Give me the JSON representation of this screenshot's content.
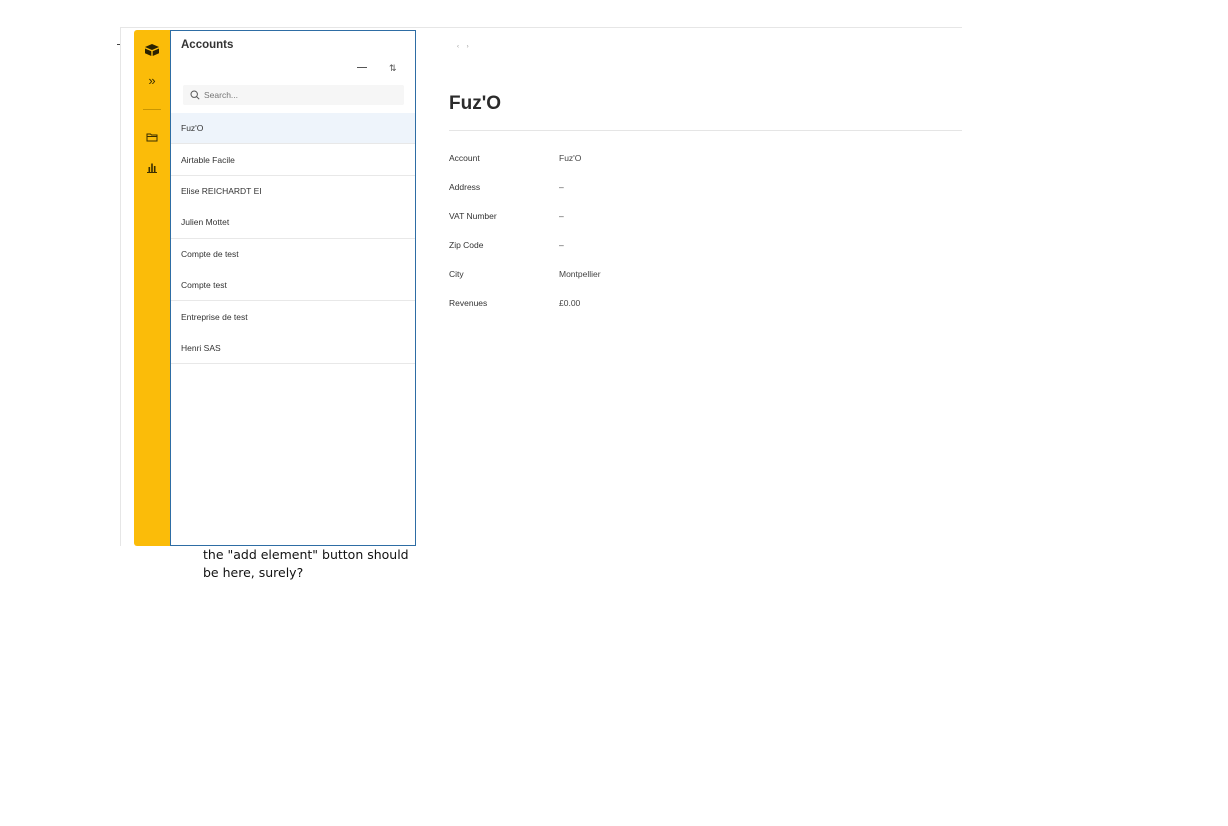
{
  "sidebar": {
    "items": [
      {
        "icon": "logo-icon"
      },
      {
        "icon": "expand-icon",
        "glyph": "»"
      },
      {
        "icon": "folder-icon"
      },
      {
        "icon": "chart-icon"
      }
    ]
  },
  "list": {
    "title": "Accounts",
    "sort_glyph": "⇅",
    "search_placeholder": "Search...",
    "items": [
      "Fuz'O",
      "Airtable Facile",
      "Elise REICHARDT EI",
      "Julien Mottet",
      "Compte de test",
      "Compte test",
      "Entreprise de test",
      "Henri SAS"
    ]
  },
  "detail": {
    "breadcrumb": "‹ ›",
    "title": "Fuz'O",
    "fields": [
      {
        "label": "Account",
        "value": "Fuz'O"
      },
      {
        "label": "Address",
        "value": "–"
      },
      {
        "label": "VAT Number",
        "value": "–"
      },
      {
        "label": "Zip Code",
        "value": "–"
      },
      {
        "label": "City",
        "value": "Montpellier"
      },
      {
        "label": "Revenues",
        "value": "£0.00"
      }
    ]
  },
  "annotation": {
    "line1": "the \"add element\" button should",
    "line2": "be here, surely?"
  },
  "colors": {
    "rail": "#fbbc09",
    "selected": "#eef4fb",
    "panel_border": "#2e6da4"
  }
}
